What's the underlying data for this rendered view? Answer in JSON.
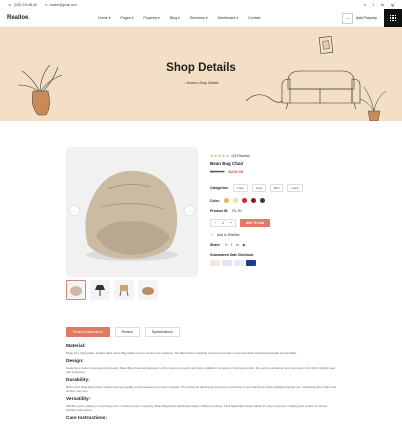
{
  "topbar": {
    "phone": "(000) 234-56-45",
    "email": "realloe@gmail.com",
    "social": [
      "x",
      "f",
      "in",
      "ig"
    ]
  },
  "header": {
    "logo": "Realloe",
    "nav": [
      "Home",
      "Pages",
      "Property",
      "Blog",
      "Elements",
      "Dashboard",
      "Contact"
    ],
    "add_property": "Add Property"
  },
  "hero": {
    "title": "Shop Details",
    "breadcrumb_home": "Home",
    "breadcrumb_current": "Shop Details"
  },
  "product": {
    "rating_text": "(15 Review)",
    "rating": 5,
    "name": "Bean Bag Chair",
    "old_price": "$289.00",
    "new_price": "$219.00",
    "category_label": "Categories:",
    "categories": [
      "Chair",
      "Sofa",
      "Bed",
      "Lamp"
    ],
    "color_label": "Color:",
    "colors": [
      "#f2b45a",
      "#f3dcb5",
      "#c8262a",
      "#8a1b1f",
      "#3a3a3a"
    ],
    "product_id_label": "Product ID:",
    "product_id": "RL-90",
    "quantity": "1",
    "add_to_cart": "Add To Cart",
    "wishlist": "Add to Wishlist",
    "share_label": "Share:",
    "guarantee": "Guaranteed Safe Checkout"
  },
  "tabs": [
    "Product Information",
    "Review",
    "Specifications"
  ],
  "description": [
    {
      "title": "Material:",
      "text": "Made from high-quality, durable fabric, Bean Bag Chairs ensure comfort and resilience. The filled fabric is carefully selected to provide a cozy feel while maintaining strength and durability."
    },
    {
      "title": "Design:",
      "text": "Featuring a modern and ergonomic design, Bean Bag Chairs are designed to offer maximum comfort and style. Available in a variety of colors and prints, they add a complement any room decor from kid to lifestyle seat with preference."
    },
    {
      "title": "Durability:",
      "text": "Built to last, Bean Bag Chairs undergo rigorous quality control measures to ensure longevity. The reinforced stitching and superior construction ensure that these chairs withstand regular use, maintaining their shape and comfort over time."
    },
    {
      "title": "Versatility:",
      "text": "Whether you're relaxing in your living room, creating a book, or gaming, Bean Bag Chairs effortlessly adapt to different settings. Their lightweight design allows for easy movement, making them perfect for various activities and spaces."
    },
    {
      "title": "Care Instructions:",
      "text": ""
    }
  ]
}
